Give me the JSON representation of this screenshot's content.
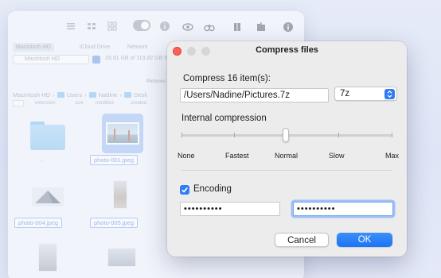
{
  "background_window": {
    "tabs": [
      "Macintosh HD",
      "iCloud Drive",
      "Network"
    ],
    "volume": "Macintosh HD",
    "free_space": "29,91 GB of 119,82 GB fr",
    "title": "Pictures",
    "breadcrumb": [
      "Macintosh HD",
      "Users",
      "Nadine",
      "Desk"
    ],
    "columns": [
      "extension",
      "size",
      "modified",
      "created"
    ],
    "items": [
      {
        "label": "..",
        "type": "folder"
      },
      {
        "label": "photo-001.jpeg",
        "type": "image",
        "selected": true
      },
      {
        "label": "photo-004.jpeg",
        "type": "image",
        "selected": true
      },
      {
        "label": "photo-005.jpeg",
        "type": "image",
        "selected": true
      }
    ]
  },
  "dialog": {
    "title": "Compress files",
    "compress_label": "Compress 16 item(s):",
    "path_value": "/Users/Nadine/Pictures.7z",
    "format": {
      "selected": "7z"
    },
    "compression": {
      "label": "Internal compression",
      "levels": [
        "None",
        "Fastest",
        "Normal",
        "Slow",
        "Max"
      ],
      "selected": "Normal"
    },
    "encoding": {
      "label": "Encoding",
      "checked": true
    },
    "password_value": "••••••••••",
    "confirm_value": "••••••••••",
    "cancel_label": "Cancel",
    "ok_label": "OK"
  },
  "colors": {
    "accent": "#2f7cf6",
    "close": "#ff5f57"
  }
}
